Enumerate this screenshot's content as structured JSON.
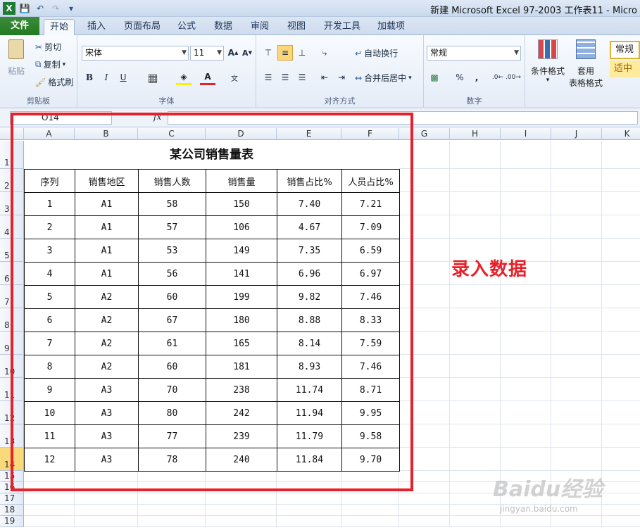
{
  "window": {
    "title": "新建 Microsoft Excel 97-2003 工作表11 - Micro"
  },
  "tabs": [
    "文件",
    "开始",
    "插入",
    "页面布局",
    "公式",
    "数据",
    "审阅",
    "视图",
    "开发工具",
    "加载项"
  ],
  "ribbon": {
    "clipboard": {
      "paste": "粘贴",
      "cut": "剪切",
      "copy": "复制",
      "format_painter": "格式刷",
      "label": "剪贴板"
    },
    "font": {
      "name": "宋体",
      "size": "11",
      "label": "字体",
      "bold": "B",
      "italic": "I",
      "underline": "U"
    },
    "alignment": {
      "wrap": "自动换行",
      "merge": "合并后居中",
      "label": "对齐方式"
    },
    "number": {
      "format": "常规",
      "percent": "%",
      "comma": ",",
      "label": "数字"
    },
    "styles": {
      "conditional": "条件格式",
      "table_format_1": "套用",
      "table_format_2": "表格格式",
      "normal": "常规",
      "neutral": "适中"
    }
  },
  "formula_bar": {
    "cell_ref": "O14",
    "fx": "fx",
    "value": ""
  },
  "columns": [
    "A",
    "B",
    "C",
    "D",
    "E",
    "F",
    "G",
    "H",
    "I",
    "J",
    "K"
  ],
  "rows": [
    "1",
    "2",
    "3",
    "4",
    "5",
    "6",
    "7",
    "8",
    "9",
    "10",
    "11",
    "12",
    "13",
    "14",
    "15",
    "16",
    "17",
    "18",
    "19"
  ],
  "selected_row": "14",
  "table": {
    "title": "某公司销售量表",
    "headers": [
      "序列",
      "销售地区",
      "销售人数",
      "销售量",
      "销售占比%",
      "人员占比%"
    ],
    "rows": [
      [
        "1",
        "A1",
        "58",
        "150",
        "7.40",
        "7.21"
      ],
      [
        "2",
        "A1",
        "57",
        "106",
        "4.67",
        "7.09"
      ],
      [
        "3",
        "A1",
        "53",
        "149",
        "7.35",
        "6.59"
      ],
      [
        "4",
        "A1",
        "56",
        "141",
        "6.96",
        "6.97"
      ],
      [
        "5",
        "A2",
        "60",
        "199",
        "9.82",
        "7.46"
      ],
      [
        "6",
        "A2",
        "67",
        "180",
        "8.88",
        "8.33"
      ],
      [
        "7",
        "A2",
        "61",
        "165",
        "8.14",
        "7.59"
      ],
      [
        "8",
        "A2",
        "60",
        "181",
        "8.93",
        "7.46"
      ],
      [
        "9",
        "A3",
        "70",
        "238",
        "11.74",
        "8.71"
      ],
      [
        "10",
        "A3",
        "80",
        "242",
        "11.94",
        "9.95"
      ],
      [
        "11",
        "A3",
        "77",
        "239",
        "11.79",
        "9.58"
      ],
      [
        "12",
        "A3",
        "78",
        "240",
        "11.84",
        "9.70"
      ]
    ]
  },
  "annotation": "录入数据",
  "watermark": {
    "brand": "Baidu经验",
    "url": "jingyan.baidu.com"
  }
}
